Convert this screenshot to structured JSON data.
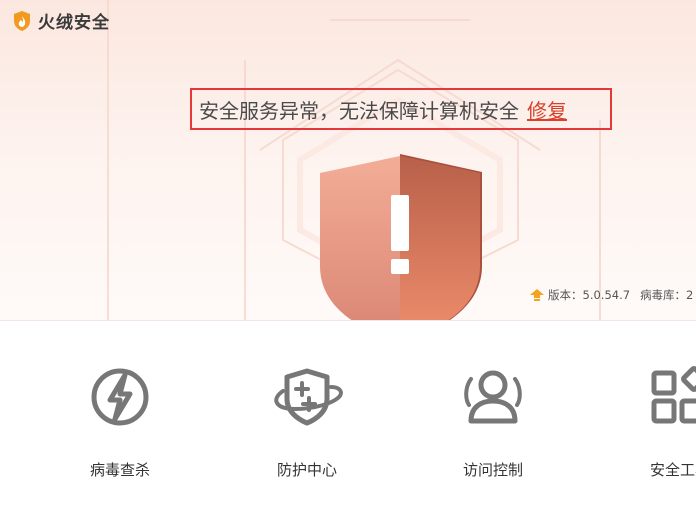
{
  "app": {
    "name": "火绒安全"
  },
  "alert": {
    "message": "安全服务异常，无法保障计算机安全",
    "action": "修复"
  },
  "status": {
    "version_text": "版本：5.0.54.7",
    "virus_db_text": "病毒库：2"
  },
  "tools": [
    {
      "label": "病毒查杀",
      "icon": "lightning-icon"
    },
    {
      "label": "防护中心",
      "icon": "shield-plus-icon"
    },
    {
      "label": "访问控制",
      "icon": "user-icon"
    },
    {
      "label": "安全工具",
      "icon": "grid-icon"
    }
  ],
  "colors": {
    "accent": "#d9402b",
    "alert_border": "#e5383b",
    "icon_gray": "#777777",
    "shield_light": "#f0a892",
    "shield_dark": "#c9694f",
    "logo_orange": "#f29a1f"
  }
}
